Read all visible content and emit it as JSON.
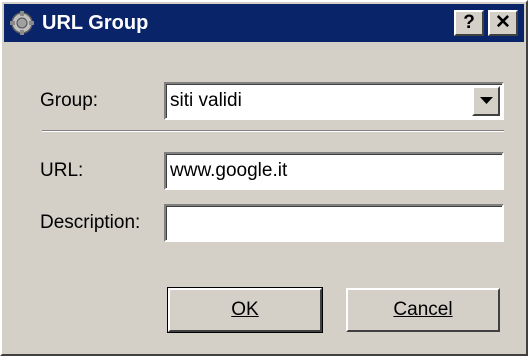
{
  "window": {
    "title": "URL Group",
    "help_glyph": "?",
    "close_glyph": "✕",
    "icon": "app-icon"
  },
  "form": {
    "group_label": "Group:",
    "group_value": "siti validi",
    "url_label": "URL:",
    "url_value": "www.google.it",
    "description_label": "Description:",
    "description_value": ""
  },
  "buttons": {
    "ok_label": "OK",
    "cancel_label": "Cancel"
  },
  "colors": {
    "titlebar": "#0a246a",
    "face": "#d4d0c8"
  }
}
